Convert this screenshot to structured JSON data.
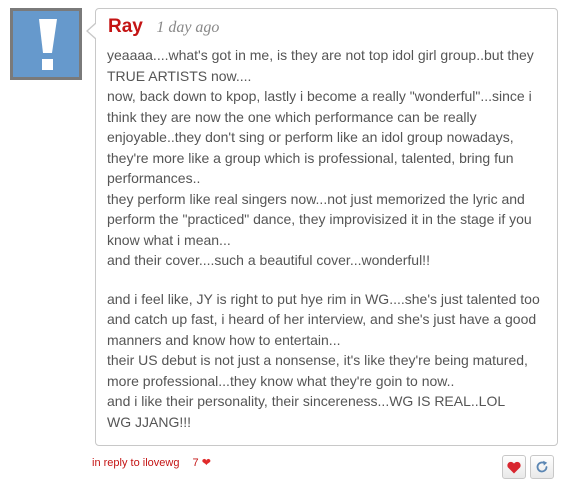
{
  "comment": {
    "author": "Ray",
    "time": "1 day ago",
    "avatar_icon": "exclamation-icon",
    "paragraphs": [
      {
        "lines": [
          " yeaaaa....what's got in me, is they are not top idol girl group..but they",
          "TRUE ARTISTS now....",
          "now, back down to kpop, lastly i become a really \"wonderful\"...since i",
          "think they are now the one which performance can be really",
          "enjoyable..they don't sing or perform like an idol group nowadays,",
          "they're more like a group which is professional, talented, bring fun",
          "performances..",
          "they perform like real singers now...not just memorized the lyric and",
          "perform the \"practiced\" dance, they improvisized it in the stage if you",
          "know what i mean...",
          "and their cover....such a beautiful cover...wonderful!!"
        ]
      },
      {
        "lines": [
          "and i feel like, JY is right to put hye rim in WG....she's just talented too",
          "and catch up fast, i heard of her interview, and she's just have a good",
          "manners and know how to entertain...",
          "their US debut is not just a nonsense, it's like they're being matured,",
          "more professional...they know what they're goin to now..",
          "and i like their personality, their sincereness...WG IS REAL..LOL",
          "WG JJANG!!!"
        ]
      }
    ]
  },
  "footer": {
    "reply_text": "in reply to ilovewg",
    "like_count": "7",
    "like_icon": "heart-icon",
    "like_button_icon": "heart-icon",
    "reblog_button_icon": "refresh-icon"
  },
  "colors": {
    "accent": "#c41414",
    "avatar_bg": "#6699cc",
    "text": "#555555",
    "border": "#c8c8c8",
    "reblog_icon": "#5b86b3"
  }
}
